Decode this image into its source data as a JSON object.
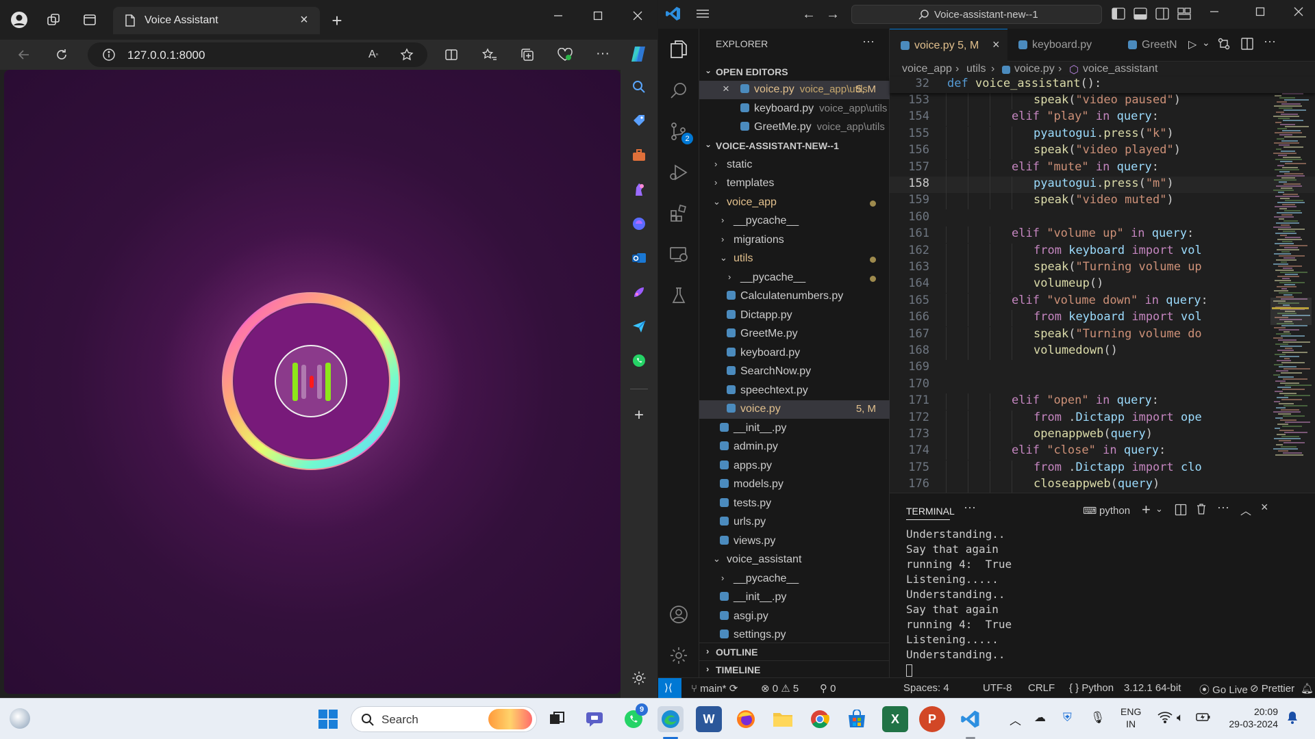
{
  "browser": {
    "tab_title": "Voice Assistant",
    "url": "127.0.0.1:8000"
  },
  "vscode": {
    "search_text": "Voice-assistant-new--1",
    "explorer": {
      "header": "EXPLORER",
      "open_editors_label": "OPEN EDITORS",
      "open_editors": [
        {
          "name": "voice.py",
          "path": "voice_app\\utils",
          "badge": "5, M"
        },
        {
          "name": "keyboard.py",
          "path": "voice_app\\utils"
        },
        {
          "name": "GreetMe.py",
          "path": "voice_app\\utils"
        }
      ],
      "project_label": "VOICE-ASSISTANT-NEW--1",
      "tree": [
        {
          "name": "static"
        },
        {
          "name": "templates"
        },
        {
          "name": "voice_app"
        },
        {
          "name": "__pycache__"
        },
        {
          "name": "migrations"
        },
        {
          "name": "utils"
        },
        {
          "name": "__pycache__"
        },
        {
          "name": "Calculatenumbers.py"
        },
        {
          "name": "Dictapp.py"
        },
        {
          "name": "GreetMe.py"
        },
        {
          "name": "keyboard.py"
        },
        {
          "name": "SearchNow.py"
        },
        {
          "name": "speechtext.py"
        },
        {
          "name": "voice.py",
          "badge": "5, M"
        },
        {
          "name": "__init__.py"
        },
        {
          "name": "admin.py"
        },
        {
          "name": "apps.py"
        },
        {
          "name": "models.py"
        },
        {
          "name": "tests.py"
        },
        {
          "name": "urls.py"
        },
        {
          "name": "views.py"
        },
        {
          "name": "voice_assistant"
        },
        {
          "name": "__pycache__"
        },
        {
          "name": "__init__.py"
        },
        {
          "name": "asgi.py"
        },
        {
          "name": "settings.py"
        }
      ],
      "outline_label": "OUTLINE",
      "timeline_label": "TIMELINE"
    },
    "tabs": [
      {
        "name": "voice.py",
        "badge": "5, M"
      },
      {
        "name": "keyboard.py"
      },
      {
        "name": "GreetN"
      }
    ],
    "breadcrumb": {
      "folder1": "voice_app",
      "folder2": "utils",
      "file": "voice.py",
      "symbol": "voice_assistant"
    },
    "sticky_line": {
      "num": "32",
      "code": "def voice_assistant():"
    },
    "code_lines": [
      {
        "num": "153",
        "code": "speak(\"video paused\")"
      },
      {
        "num": "154",
        "code": "elif \"play\" in query:"
      },
      {
        "num": "155",
        "code": "pyautogui.press(\"k\")"
      },
      {
        "num": "156",
        "code": "speak(\"video played\")"
      },
      {
        "num": "157",
        "code": "elif \"mute\" in query:"
      },
      {
        "num": "158",
        "code": "pyautogui.press(\"m\")"
      },
      {
        "num": "159",
        "code": "speak(\"video muted\")"
      },
      {
        "num": "160",
        "code": ""
      },
      {
        "num": "161",
        "code": "elif \"volume up\" in query:"
      },
      {
        "num": "162",
        "code": "from keyboard import vol"
      },
      {
        "num": "163",
        "code": "speak(\"Turning volume up"
      },
      {
        "num": "164",
        "code": "volumeup()"
      },
      {
        "num": "165",
        "code": "elif \"volume down\" in query:"
      },
      {
        "num": "166",
        "code": "from keyboard import vol"
      },
      {
        "num": "167",
        "code": "speak(\"Turning volume do"
      },
      {
        "num": "168",
        "code": "volumedown()"
      },
      {
        "num": "169",
        "code": ""
      },
      {
        "num": "170",
        "code": ""
      },
      {
        "num": "171",
        "code": "elif \"open\" in query:"
      },
      {
        "num": "172",
        "code": "from .Dictapp import ope"
      },
      {
        "num": "173",
        "code": "openappweb(query)"
      },
      {
        "num": "174",
        "code": "elif \"close\" in query:"
      },
      {
        "num": "175",
        "code": "from .Dictapp import clo"
      },
      {
        "num": "176",
        "code": "closeappweb(query)"
      }
    ],
    "terminal": {
      "tab_label": "TERMINAL",
      "shell_label": "python",
      "lines": [
        "Understanding..",
        "Say that again",
        "running 4:  True",
        "Listening.....",
        "Understanding..",
        "Say that again",
        "running 4:  True",
        "Listening.....",
        "Understanding.."
      ]
    },
    "status": {
      "branch": "main*",
      "errors": "0",
      "warnings": "5",
      "ports": "0",
      "spaces": "Spaces: 4",
      "encoding": "UTF-8",
      "eol": "CRLF",
      "language": "Python",
      "interpreter": "3.12.1 64-bit",
      "golive": "Go Live",
      "prettier": "Prettier"
    },
    "source_control_badge": "2"
  },
  "taskbar": {
    "search_placeholder": "Search",
    "whatsapp_badge": "9",
    "lang_top": "ENG",
    "lang_bottom": "IN",
    "time": "20:09",
    "date": "29-03-2024"
  }
}
